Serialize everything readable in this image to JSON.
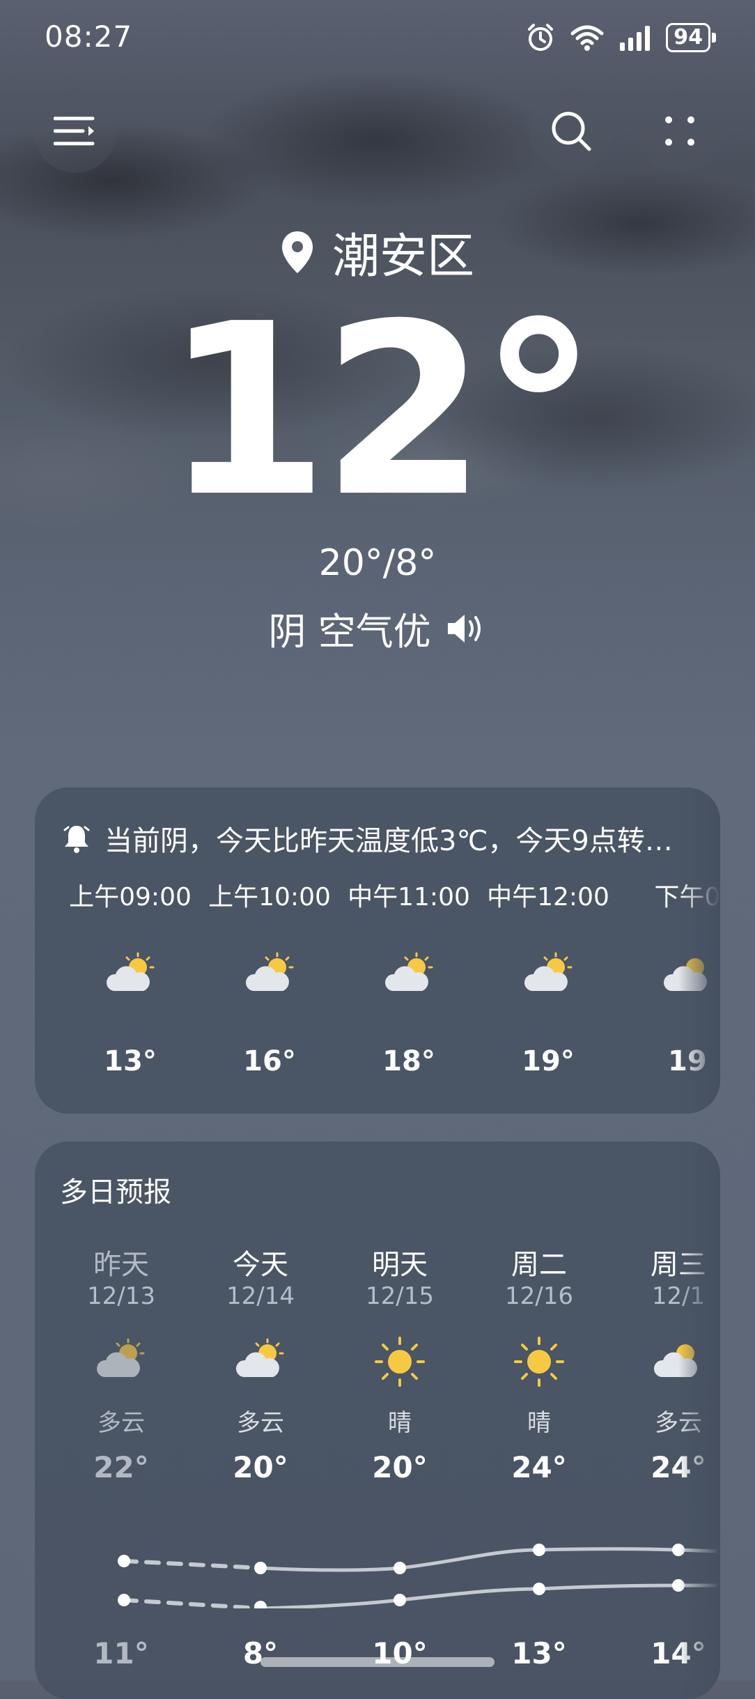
{
  "status": {
    "time": "08:27",
    "battery": "94"
  },
  "location": {
    "name": "潮安区"
  },
  "current": {
    "temp": "12°",
    "hilo": "20°/8°",
    "condition": "阴 空气优"
  },
  "alert": {
    "text": "当前阴，今天比昨天温度低3℃，今天9点转…"
  },
  "hourly": [
    {
      "time": "上午09:00",
      "temp": "13°",
      "icon": "partly-cloudy-icon"
    },
    {
      "time": "上午10:00",
      "temp": "16°",
      "icon": "partly-cloudy-icon"
    },
    {
      "time": "中午11:00",
      "temp": "18°",
      "icon": "partly-cloudy-icon"
    },
    {
      "time": "中午12:00",
      "temp": "19°",
      "icon": "partly-cloudy-icon"
    },
    {
      "time": "下午0",
      "temp": "19",
      "icon": "partly-cloudy-icon"
    }
  ],
  "daily": {
    "title": "多日预报",
    "days": [
      {
        "name": "昨天",
        "date": "12/13",
        "desc": "多云",
        "hi": "22°",
        "lo": "11°",
        "icon": "partly-cloudy-icon"
      },
      {
        "name": "今天",
        "date": "12/14",
        "desc": "多云",
        "hi": "20°",
        "lo": "8°",
        "icon": "partly-cloudy-icon"
      },
      {
        "name": "明天",
        "date": "12/15",
        "desc": "晴",
        "hi": "20°",
        "lo": "10°",
        "icon": "sun-icon"
      },
      {
        "name": "周二",
        "date": "12/16",
        "desc": "晴",
        "hi": "24°",
        "lo": "13°",
        "icon": "sun-icon"
      },
      {
        "name": "周三",
        "date": "12/1",
        "desc": "多云",
        "hi": "24°",
        "lo": "14°",
        "icon": "partly-cloudy-icon"
      }
    ]
  },
  "colors": {
    "sun": "#f6c945",
    "cloud": "#e3e6ea",
    "card": "#46505f"
  }
}
